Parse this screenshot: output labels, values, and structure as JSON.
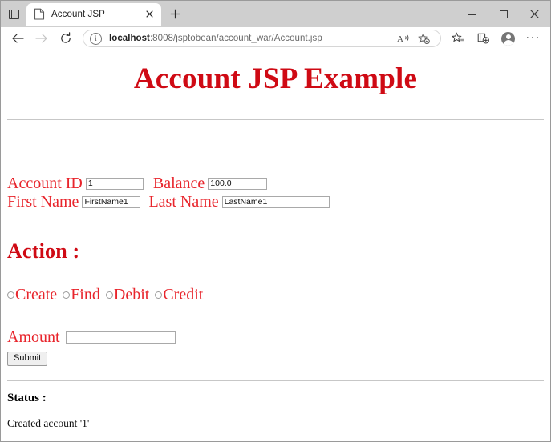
{
  "browser": {
    "tab": {
      "title": "Account JSP",
      "favicon_icon": "page-icon",
      "close_icon": "close-icon"
    },
    "new_tab_label": "+",
    "vertical_tabs_icon": "vertical-tabs-icon",
    "window_controls": {
      "minimize": "minimize-icon",
      "maximize": "maximize-icon",
      "close": "close-icon"
    },
    "nav": {
      "back_icon": "back-arrow-icon",
      "forward_icon": "forward-arrow-icon",
      "reload_icon": "reload-icon"
    },
    "omnibox": {
      "info_icon": "info-icon",
      "info_glyph": "i",
      "url_host": "localhost",
      "url_rest": ":8008/jsptobean/account_war/Account.jsp",
      "url_full": "localhost:8008/jsptobean/account_war/Account.jsp",
      "read_aloud_icon": "read-aloud-icon",
      "add_favorite_icon": "add-favorite-star-icon"
    },
    "toolbar": {
      "favorites_icon": "favorites-icon",
      "collections_icon": "browser-essentials-icon",
      "profile_icon": "profile-avatar-icon",
      "settings_icon": "settings-more-icon",
      "settings_glyph": "···"
    }
  },
  "page": {
    "title": "Account JSP Example",
    "fields": {
      "account_id_label": "Account ID",
      "account_id_value": "1",
      "balance_label": "Balance",
      "balance_value": "100.0",
      "first_name_label": "First Name",
      "first_name_value": "FirstName1",
      "last_name_label": "Last Name",
      "last_name_value": "LastName1"
    },
    "action": {
      "heading": "Action :",
      "options": [
        {
          "label": "Create",
          "checked": false
        },
        {
          "label": "Find",
          "checked": false
        },
        {
          "label": "Debit",
          "checked": false
        },
        {
          "label": "Credit",
          "checked": false
        }
      ]
    },
    "amount": {
      "label": "Amount",
      "value": ""
    },
    "submit_label": "Submit",
    "status": {
      "heading": "Status :",
      "message": "Created account '1'"
    },
    "colors": {
      "heading_red": "#cf0a14",
      "label_red": "#e8252c",
      "rule_gray": "#c7c7c7"
    }
  }
}
